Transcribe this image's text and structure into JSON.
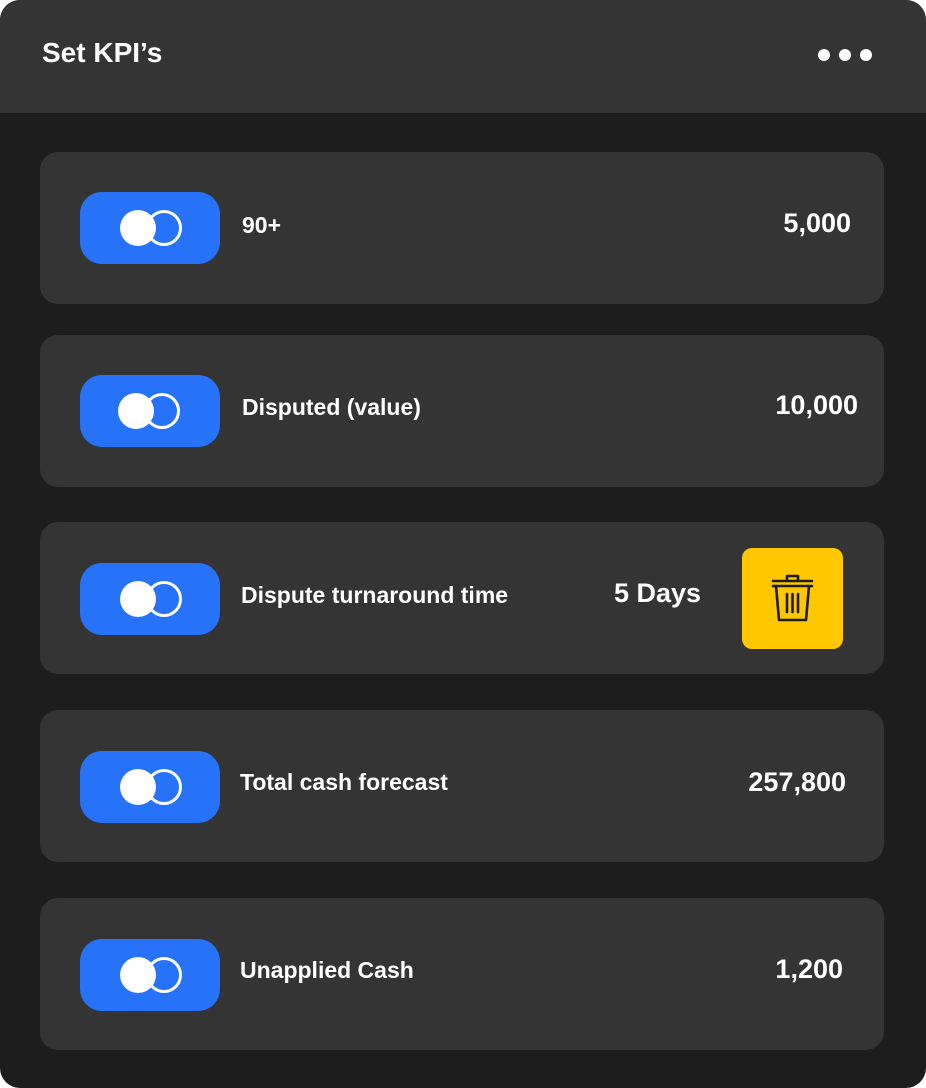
{
  "panel": {
    "title": "Set KPI’s",
    "more_icon": "more-horizontal-icon"
  },
  "colors": {
    "background": "#1d1d1d",
    "header": "#343434",
    "card": "#343434",
    "toggle": "#2673fa",
    "delete_button": "#ffc700",
    "text": "#ffffff"
  },
  "kpis": [
    {
      "label": "90+",
      "value": "5,000",
      "enabled": true
    },
    {
      "label": "Disputed (value)",
      "value": "10,000",
      "enabled": true
    },
    {
      "label": "Dispute turnaround time",
      "value": "5 Days",
      "enabled": true,
      "delete_icon": "trash-icon"
    },
    {
      "label": "Total cash forecast",
      "value": "257,800",
      "enabled": true
    },
    {
      "label": "Unapplied Cash",
      "value": "1,200",
      "enabled": true
    }
  ]
}
